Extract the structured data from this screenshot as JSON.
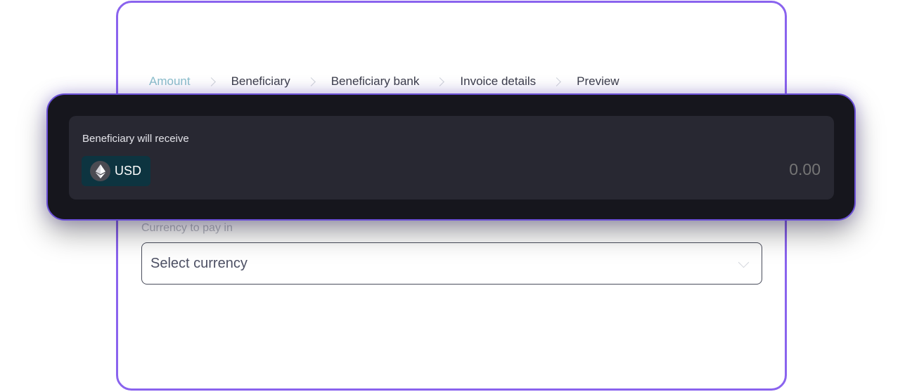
{
  "stepper": {
    "steps": [
      {
        "label": "Amount",
        "active": true
      },
      {
        "label": "Beneficiary",
        "active": false
      },
      {
        "label": "Beneficiary bank",
        "active": false
      },
      {
        "label": "Invoice details",
        "active": false
      },
      {
        "label": "Preview",
        "active": false
      }
    ]
  },
  "receive": {
    "label": "Beneficiary will receive",
    "currency": "USD",
    "currency_icon": "ethereum-icon",
    "amount": "0.00"
  },
  "pay": {
    "label": "Currency to pay in",
    "placeholder": "Select currency"
  },
  "colors": {
    "accent": "#8a63ee",
    "active_step": "#8bbfcc",
    "chip_bg": "#0d3440"
  }
}
